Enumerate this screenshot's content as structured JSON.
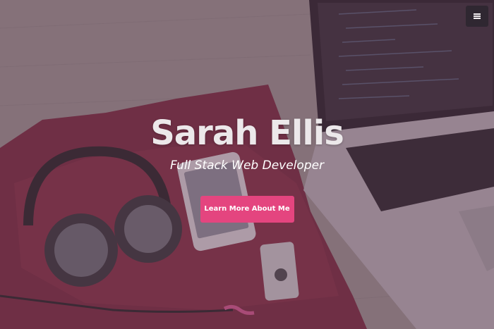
{
  "header": {
    "menu_icon": "hamburger-menu-icon"
  },
  "hero": {
    "title": "Sarah Ellis",
    "subtitle": "Full Stack Web Developer",
    "cta_label": "Learn More About Me"
  },
  "colors": {
    "accent": "#e4457f",
    "overlay": "#5c3a52",
    "menu_button_bg": "#28242c",
    "text": "#ffffff"
  }
}
